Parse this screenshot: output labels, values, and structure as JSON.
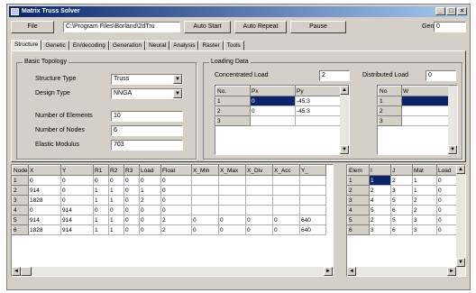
{
  "window": {
    "title": "Matrix Truss Solver"
  },
  "toolbar": {
    "file_label": "File",
    "path_value": "C:\\Program Files\\Borland\\2dTru",
    "auto_start_label": "Auto Start",
    "auto_repeat_label": "Auto Repeat",
    "pause_label": "Pause",
    "gen_label": "Gen",
    "gen_value": "0"
  },
  "tabs": [
    "Structure",
    "Genetic",
    "En/decoding",
    "Generation",
    "Neural",
    "Analysis",
    "Raster",
    "Tools"
  ],
  "basic_topology": {
    "title": "Basic Topology",
    "structure_type_label": "Structure Type",
    "structure_type_value": "Truss",
    "design_type_label": "Design Type",
    "design_type_value": "NNGA",
    "num_elements_label": "Number of Elements",
    "num_elements_value": "10",
    "num_nodes_label": "Number of Nodes",
    "num_nodes_value": "6",
    "elastic_modulus_label": "Elastic Modulus",
    "elastic_modulus_value": "703"
  },
  "loading_data": {
    "title": "Loading Data",
    "concentrated_label": "Concentrated Load",
    "concentrated_value": "2",
    "distributed_label": "Distributed Load",
    "distributed_value": "0",
    "conc_headers": [
      "No.",
      "Px",
      "Py"
    ],
    "conc_rows": [
      [
        "1",
        "0",
        "-45.3"
      ],
      [
        "2",
        "0",
        "-45.3"
      ],
      [
        "3",
        "",
        ""
      ]
    ],
    "dist_headers": [
      "No",
      "W"
    ],
    "dist_rows": [
      [
        "1",
        ""
      ],
      [
        "2",
        ""
      ],
      [
        "3",
        ""
      ]
    ]
  },
  "node_table": {
    "headers": [
      "Node",
      "X",
      "Y",
      "R1",
      "R2",
      "R3",
      "Load",
      "Float",
      "X_Min",
      "X_Max",
      "X_Div",
      "X_Acc",
      "Y_"
    ],
    "rows": [
      [
        "1",
        "0",
        "0",
        "0",
        "0",
        "0",
        "0",
        "0",
        "",
        "",
        "",
        "",
        ""
      ],
      [
        "2",
        "914",
        "0",
        "1",
        "1",
        "0",
        "1",
        "0",
        "",
        "",
        "",
        "",
        ""
      ],
      [
        "3",
        "1828",
        "0",
        "1",
        "1",
        "0",
        "2",
        "0",
        "",
        "",
        "",
        "",
        ""
      ],
      [
        "4",
        "0",
        "914",
        "0",
        "0",
        "0",
        "0",
        "0",
        "",
        "",
        "",
        "",
        ""
      ],
      [
        "5",
        "914",
        "914",
        "1",
        "1",
        "0",
        "0",
        "2",
        "0",
        "0",
        "0",
        "0",
        "640"
      ],
      [
        "6",
        "1828",
        "914",
        "1",
        "1",
        "0",
        "0",
        "2",
        "0",
        "0",
        "0",
        "0",
        "640"
      ]
    ]
  },
  "elem_table": {
    "headers": [
      "Elem",
      "I",
      "J",
      "Mat",
      "Load"
    ],
    "rows": [
      [
        "1",
        "1",
        "2",
        "1",
        "0"
      ],
      [
        "2",
        "2",
        "3",
        "1",
        "0"
      ],
      [
        "3",
        "4",
        "5",
        "2",
        "0"
      ],
      [
        "4",
        "5",
        "6",
        "2",
        "0"
      ],
      [
        "5",
        "2",
        "5",
        "3",
        "0"
      ],
      [
        "6",
        "3",
        "6",
        "3",
        "0"
      ]
    ]
  }
}
